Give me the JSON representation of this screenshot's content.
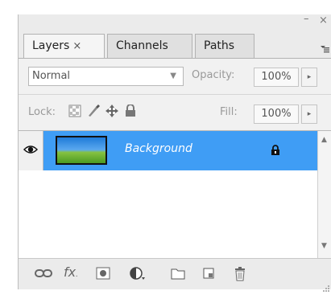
{
  "panel": {
    "controls": {
      "minimize": "–",
      "close": "×"
    },
    "tabs": [
      {
        "label": "Layers",
        "close": "×",
        "active": true
      },
      {
        "label": "Channels",
        "active": false
      },
      {
        "label": "Paths",
        "active": false
      }
    ],
    "menu_glyph": "▾≡"
  },
  "blend_mode": {
    "value": "Normal",
    "arrow": "▼"
  },
  "opacity": {
    "label": "Opacity:",
    "value": "100%",
    "stepper": "▸"
  },
  "lock": {
    "label": "Lock:",
    "icons": [
      "lock-transparent-pixels-icon",
      "lock-image-pixels-icon",
      "lock-position-icon",
      "lock-all-icon"
    ]
  },
  "fill": {
    "label": "Fill:",
    "value": "100%",
    "stepper": "▸"
  },
  "layers": [
    {
      "name": "Background",
      "visible": true,
      "locked": true,
      "selected": true
    }
  ],
  "scrollbar": {
    "up": "▲",
    "down": "▼"
  },
  "footer_icons": [
    "link-layers-icon",
    "add-layer-style-icon",
    "add-layer-mask-icon",
    "new-adjustment-layer-icon",
    "new-group-icon",
    "new-layer-icon",
    "delete-layer-icon"
  ],
  "colors": {
    "selected_row": "#3f9df5",
    "panel_bg": "#ebebeb"
  }
}
